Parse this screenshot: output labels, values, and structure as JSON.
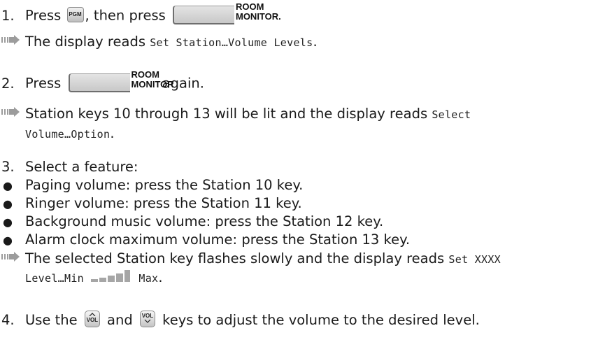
{
  "step1": {
    "number": "1.",
    "text_a": "Press",
    "pgm_key": "PGM",
    "text_b": ", then press",
    "text_c": "."
  },
  "room_monitor_key": {
    "line1": "ROOM",
    "line2": "MONITOR"
  },
  "result1": {
    "text": "The display reads",
    "display": "Set Station…Volume Levels",
    "end": "."
  },
  "step2": {
    "number": "2.",
    "text_a": "Press",
    "text_b": "again."
  },
  "result2": {
    "line1_text": "Station keys 10 through 13 will be lit and the display reads",
    "line1_display": "Select",
    "line2_display": "Volume…Option",
    "end": "."
  },
  "step3": {
    "number": "3.",
    "text": "Select a feature:",
    "bullets": [
      "Paging volume: press the Station 10 key.",
      "Ringer volume: press the Station 11 key.",
      "Background music volume: press the Station 12 key.",
      "Alarm clock maximum volume: press the Station 13 key."
    ]
  },
  "result3": {
    "line1_text": "The selected Station key flashes slowly and the display reads",
    "line1_display": "Set XXXX",
    "line2_display_a": "Level…Min",
    "line2_display_b": "Max",
    "end": "."
  },
  "step4": {
    "number": "4.",
    "text_a": "Use the",
    "vol_up_key": "VOL",
    "text_b": "and",
    "vol_down_key": "VOL",
    "text_c": "keys to adjust the volume to the desired level."
  },
  "icons": {
    "result_arrow": "arrow-right-icon",
    "bullet": "bullet-icon"
  },
  "colors": {
    "text": "#1a1a1a",
    "arrow": "#9c9c9c",
    "key_face": "#d0d0d0"
  }
}
